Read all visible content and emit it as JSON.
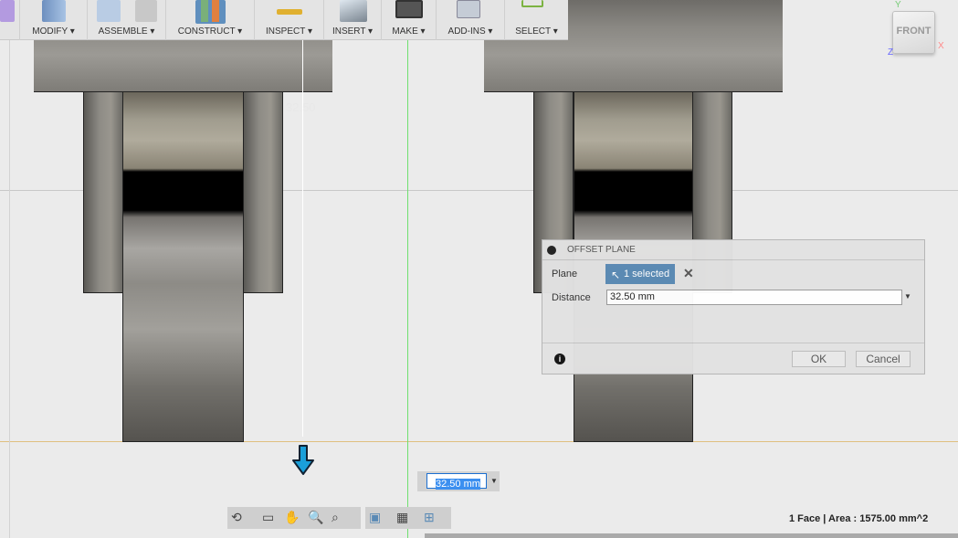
{
  "toolbar": {
    "groups": [
      {
        "label": "MODIFY",
        "icon": "modify-icon"
      },
      {
        "label": "ASSEMBLE",
        "icon": "assemble-icon"
      },
      {
        "label": "CONSTRUCT",
        "icon": "construct-icon"
      },
      {
        "label": "INSPECT",
        "icon": "ruler-icon"
      },
      {
        "label": "INSERT",
        "icon": "insert-image-icon"
      },
      {
        "label": "MAKE",
        "icon": "3d-print-icon"
      },
      {
        "label": "ADD-INS",
        "icon": "scripts-gear-icon"
      },
      {
        "label": "SELECT",
        "icon": "select-cursor-icon"
      }
    ],
    "active_group": "CONSTRUCT"
  },
  "viewcube": {
    "face": "FRONT",
    "axes": [
      "Y",
      "X",
      "Z"
    ]
  },
  "viewport": {
    "dimension_label": "32.50",
    "accent_color": "#1a9fd9"
  },
  "dialog": {
    "title": "OFFSET PLANE",
    "plane_label": "Plane",
    "plane_value": "1 selected",
    "distance_label": "Distance",
    "distance_value": "32.50 mm",
    "ok": "OK",
    "cancel": "Cancel"
  },
  "inline_input": {
    "value": "32.50 mm"
  },
  "status": {
    "text": "1 Face | Area : 1575.00 mm^2"
  }
}
